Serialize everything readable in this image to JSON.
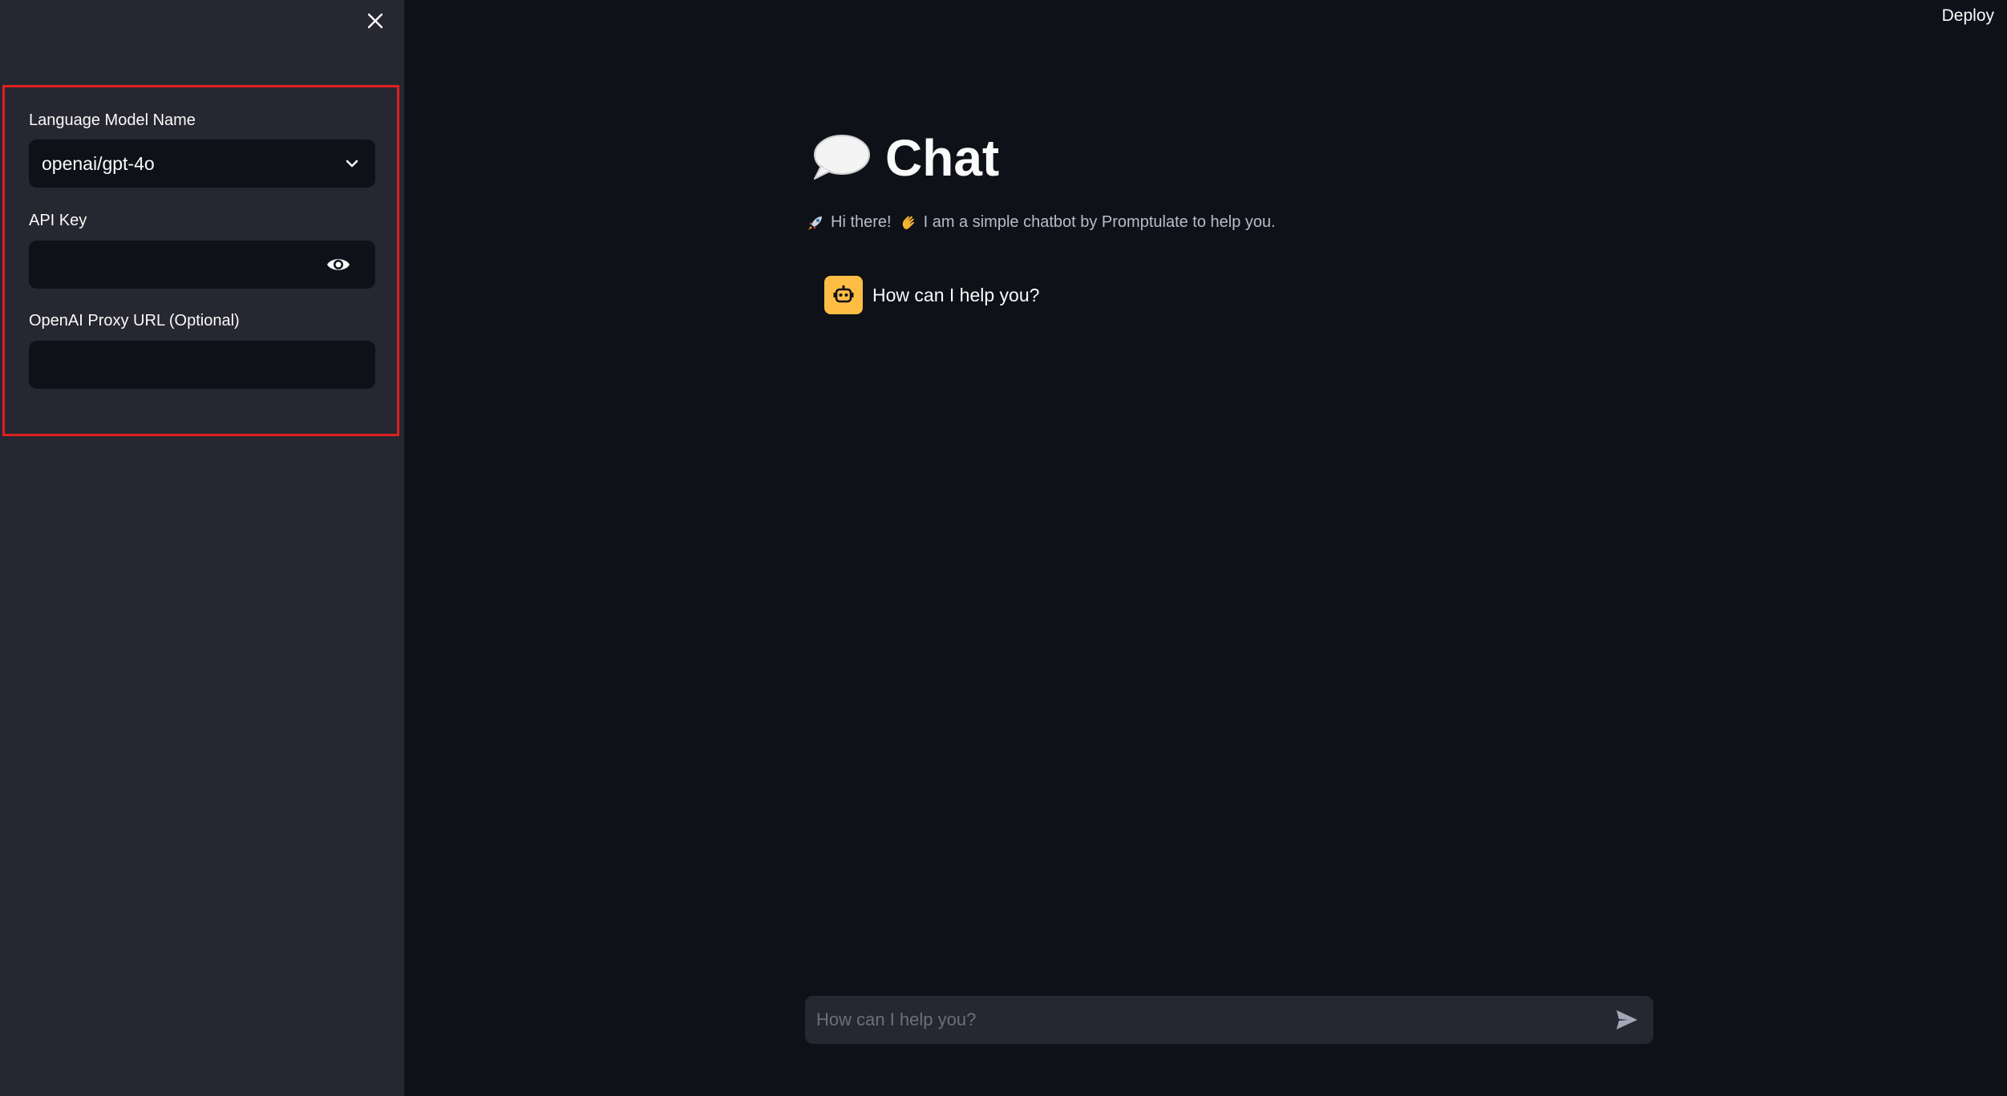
{
  "header": {
    "deploy_label": "Deploy"
  },
  "sidebar": {
    "model_field": {
      "label": "Language Model Name",
      "value": "openai/gpt-4o"
    },
    "api_key_field": {
      "label": "API Key",
      "value": ""
    },
    "proxy_field": {
      "label": "OpenAI Proxy URL (Optional)",
      "value": ""
    }
  },
  "main": {
    "title": "Chat",
    "intro_greeting": "Hi there!",
    "intro_text": "I am a simple chatbot by Promptulate to help you.",
    "messages": [
      {
        "role": "assistant",
        "text": "How can I help you?"
      }
    ]
  },
  "chat_input": {
    "placeholder": "How can I help you?"
  },
  "colors": {
    "background": "#0e1117",
    "sidebar": "#262730",
    "avatar": "#ffbd45",
    "highlight": "#e02020"
  },
  "icons": {
    "close": "close-icon",
    "chevron": "chevron-down-icon",
    "eye": "eye-icon",
    "speech": "speech-bubble-icon",
    "rocket": "rocket-icon",
    "wave": "waving-hand-icon",
    "bot": "robot-icon",
    "send": "send-icon"
  }
}
